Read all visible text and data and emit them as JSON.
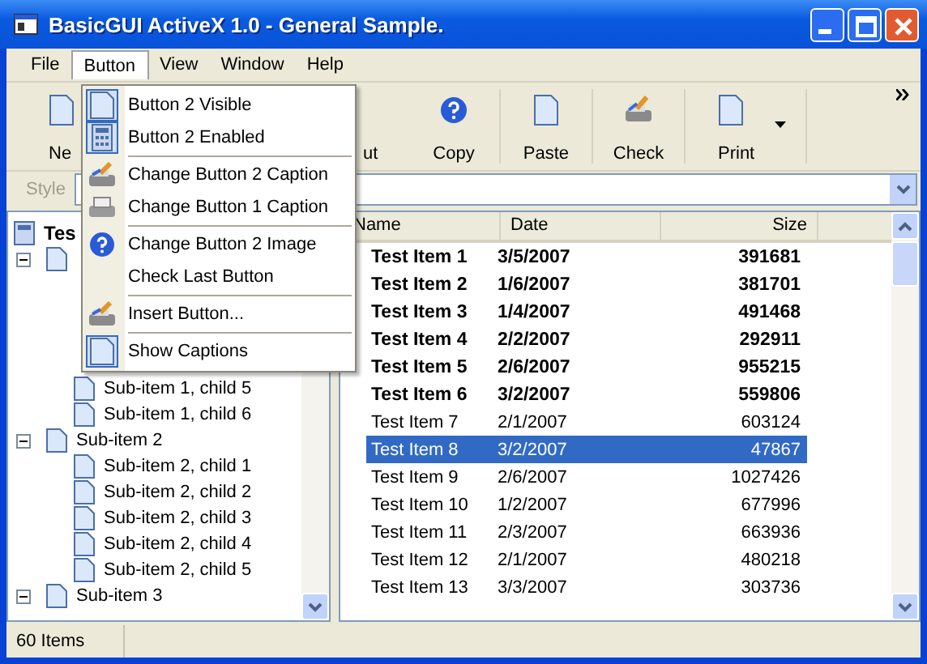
{
  "window": {
    "title": "BasicGUI ActiveX 1.0 - General Sample."
  },
  "menu_bar": [
    {
      "label": "File",
      "selected": false
    },
    {
      "label": "Button",
      "selected": true
    },
    {
      "label": "View",
      "selected": false
    },
    {
      "label": "Window",
      "selected": false
    },
    {
      "label": "Help",
      "selected": false
    }
  ],
  "menu": [
    {
      "kind": "item",
      "label": "Button 2 Visible",
      "checked": true
    },
    {
      "kind": "item",
      "label": "Button 2 Enabled",
      "checked": true
    },
    {
      "kind": "separator"
    },
    {
      "kind": "item",
      "label": "Change Button 2 Caption",
      "checked": false
    },
    {
      "kind": "item",
      "label": "Change Button 1 Caption",
      "checked": false
    },
    {
      "kind": "separator"
    },
    {
      "kind": "item",
      "label": "Change Button 2 Image",
      "checked": false
    },
    {
      "kind": "item",
      "label": "Check Last Button",
      "checked": false
    },
    {
      "kind": "separator"
    },
    {
      "kind": "item",
      "label": "Insert Button...",
      "checked": false
    },
    {
      "kind": "separator"
    },
    {
      "kind": "item",
      "label": "Show Captions",
      "checked": true
    }
  ],
  "toolbar": [
    {
      "label": "Ne",
      "kind": "button"
    },
    {
      "label": "ut",
      "kind": "button"
    },
    {
      "label": "Copy",
      "kind": "button"
    },
    {
      "label": "Paste",
      "kind": "button"
    },
    {
      "label": "Check",
      "kind": "button"
    },
    {
      "label": "Print",
      "kind": "dropdown"
    }
  ],
  "style_bar": {
    "label": "Style",
    "disabled": true
  },
  "tree": {
    "label": "Tes",
    "children": [
      {
        "expanded": true,
        "children": [
          {
            "label": "Sub-item 1, child 5"
          },
          {
            "label": "Sub-item 1, child 6"
          }
        ]
      },
      {
        "label": "Sub-item 2",
        "expanded": true,
        "children": [
          {
            "label": "Sub-item 2, child 1"
          },
          {
            "label": "Sub-item 2, child 2"
          },
          {
            "label": "Sub-item 2, child 3"
          },
          {
            "label": "Sub-item 2, child 4"
          },
          {
            "label": "Sub-item 2, child 5"
          }
        ]
      },
      {
        "label": "Sub-item 3",
        "expanded": true
      }
    ]
  },
  "list": {
    "columns": [
      "Name",
      "Date",
      "Size"
    ],
    "rows": [
      {
        "name": "Test Item 1",
        "date": "3/5/2007",
        "size": "391681",
        "bold": true,
        "selected": false
      },
      {
        "name": "Test Item 2",
        "date": "1/6/2007",
        "size": "381701",
        "bold": true,
        "selected": false
      },
      {
        "name": "Test Item 3",
        "date": "1/4/2007",
        "size": "491468",
        "bold": true,
        "selected": false
      },
      {
        "name": "Test Item 4",
        "date": "2/2/2007",
        "size": "292911",
        "bold": true,
        "selected": false
      },
      {
        "name": "Test Item 5",
        "date": "2/6/2007",
        "size": "955215",
        "bold": true,
        "selected": false
      },
      {
        "name": "Test Item 6",
        "date": "3/2/2007",
        "size": "559806",
        "bold": true,
        "selected": false
      },
      {
        "name": "Test Item 7",
        "date": "2/1/2007",
        "size": "603124",
        "bold": false,
        "selected": false
      },
      {
        "name": "Test Item 8",
        "date": "3/2/2007",
        "size": "47867",
        "bold": false,
        "selected": true
      },
      {
        "name": "Test Item 9",
        "date": "2/6/2007",
        "size": "1027426",
        "bold": false,
        "selected": false
      },
      {
        "name": "Test Item 10",
        "date": "1/2/2007",
        "size": "677996",
        "bold": false,
        "selected": false
      },
      {
        "name": "Test Item 11",
        "date": "2/3/2007",
        "size": "663936",
        "bold": false,
        "selected": false
      },
      {
        "name": "Test Item 12",
        "date": "2/1/2007",
        "size": "480218",
        "bold": false,
        "selected": false
      },
      {
        "name": "Test Item 13",
        "date": "3/3/2007",
        "size": "303736",
        "bold": false,
        "selected": false
      }
    ]
  },
  "status_bar": {
    "text": "60 Items"
  }
}
